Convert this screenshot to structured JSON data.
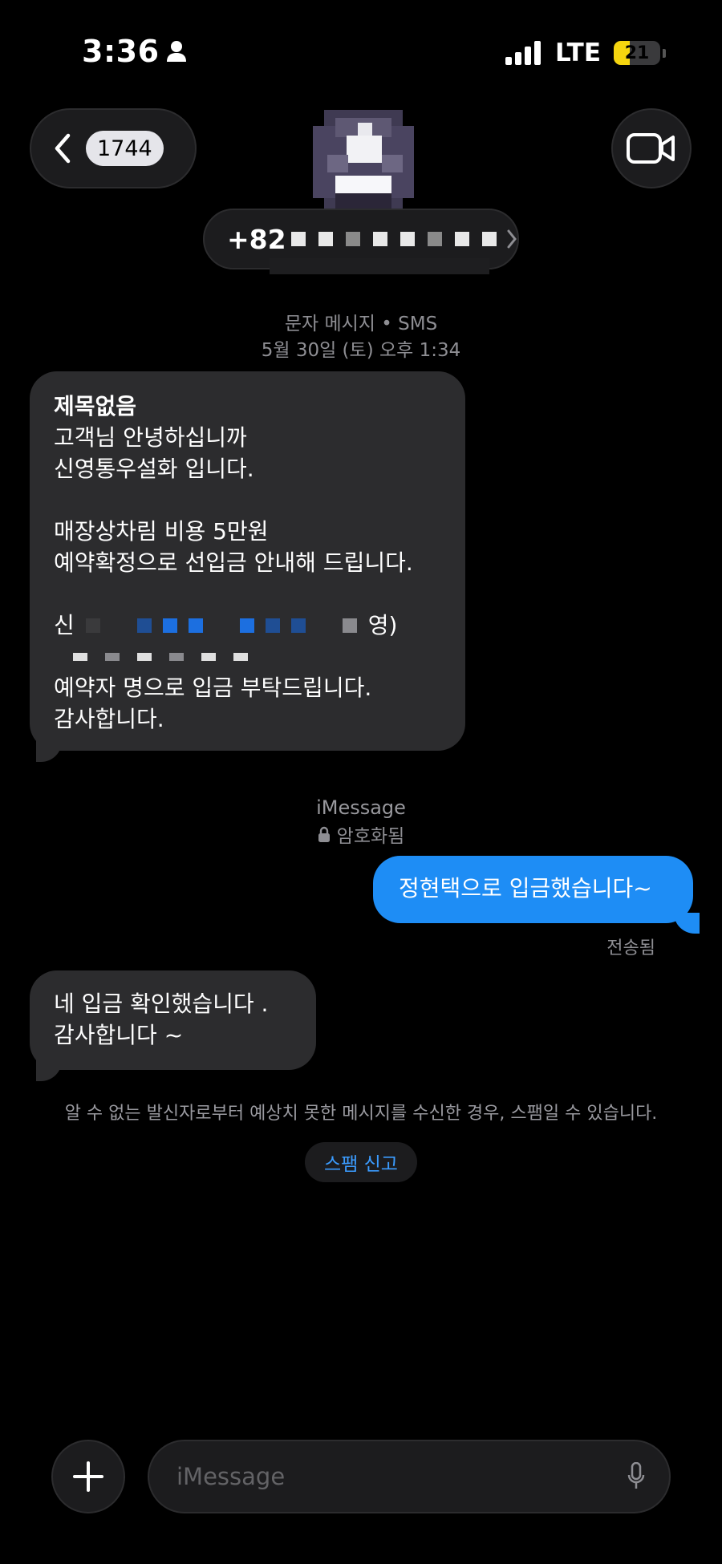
{
  "status_bar": {
    "time": "3:36",
    "network": "LTE",
    "battery": "21",
    "battery_level": 0.21
  },
  "header": {
    "back_count": "1744",
    "contact_number_visible": "+82"
  },
  "thread_meta": {
    "service": "문자 메시지 • SMS",
    "timestamp": "5월 30일 (토) 오후 1:34"
  },
  "messages": {
    "sms": {
      "subject": "제목없음",
      "line1": "고객님 안녕하십니까",
      "line2": "신영통우설화 입니다.",
      "line3": "매장상차림 비용 5만원",
      "line4": "예약확정으로 선입금 안내해 드립니다.",
      "account_start": "신",
      "account_end": "영)",
      "line5": "예약자 명으로 입금 부탁드립니다.",
      "line6": "감사합니다."
    },
    "imessage_label": "iMessage",
    "encrypted_label": "암호화됨",
    "outgoing": "정현택으로 입금했습니다~",
    "delivered": "전송됨",
    "reply_line1": "네 입금 확인했습니다 .",
    "reply_line2": "감사합니다 ~"
  },
  "spam": {
    "notice": "알 수 없는 발신자로부터 예상치 못한 메시지를 수신한 경우, 스팸일 수 있습니다.",
    "report_button": "스팸 신고"
  },
  "composer": {
    "placeholder": "iMessage"
  },
  "colors": {
    "background": "#000000",
    "incoming_bubble": "#2c2c2e",
    "outgoing_bubble": "#1e8df5",
    "link_blue": "#3b9cff",
    "battery_yellow": "#f5d50f"
  }
}
